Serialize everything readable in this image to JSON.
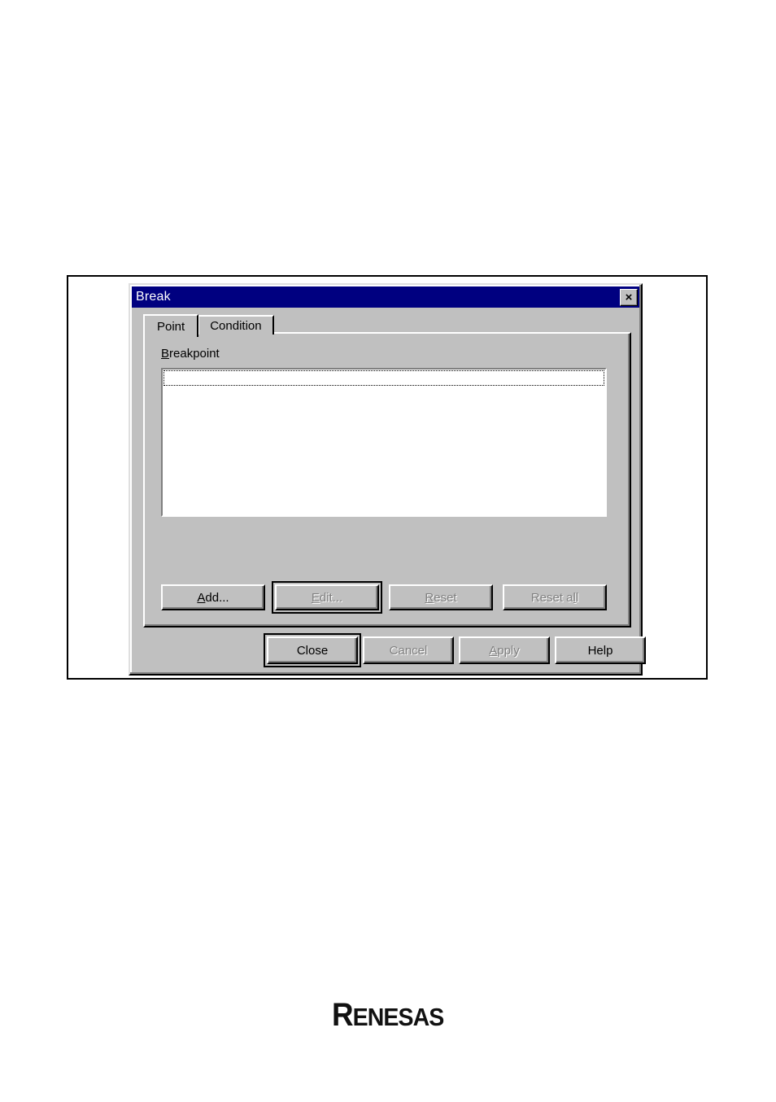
{
  "dialog": {
    "title": "Break",
    "close_icon": "×",
    "tabs": [
      {
        "label": "Point",
        "active": true
      },
      {
        "label": "Condition",
        "active": false
      }
    ],
    "point_tab": {
      "group_label": "Breakpoint",
      "group_label_mnemonic": "B",
      "listbox": {
        "items": [],
        "focused_row_text": ""
      },
      "buttons": [
        {
          "label": "Add...",
          "mnemonic": "A",
          "enabled": true,
          "default": false
        },
        {
          "label": "Edit...",
          "mnemonic": "E",
          "enabled": false,
          "default": true
        },
        {
          "label": "Reset",
          "mnemonic": "R",
          "enabled": false,
          "default": false
        },
        {
          "label": "Reset all",
          "mnemonic": "l",
          "enabled": false,
          "default": false
        }
      ]
    },
    "bottom_buttons": [
      {
        "label": "Close",
        "mnemonic": "",
        "enabled": true,
        "default": true
      },
      {
        "label": "Cancel",
        "mnemonic": "",
        "enabled": false,
        "default": false
      },
      {
        "label": "Apply",
        "mnemonic": "A",
        "enabled": false,
        "default": false
      },
      {
        "label": "Help",
        "mnemonic": "",
        "enabled": true,
        "default": false
      }
    ]
  },
  "footer": {
    "logo_text": "RENESAS",
    "logo_cap": "R",
    "logo_rest": "ENESAS"
  },
  "colors": {
    "titlebar": "#000080",
    "face": "#c0c0c0",
    "shadow": "#808080",
    "highlight": "#ffffff",
    "window": "#ffffff",
    "text": "#000000",
    "disabled_text": "#808080"
  }
}
